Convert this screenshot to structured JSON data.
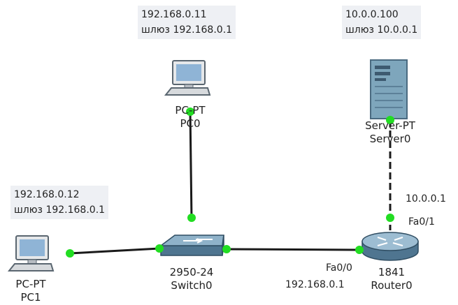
{
  "notes": {
    "pc0": {
      "ip": "192.168.0.11",
      "gateway": "шлюз 192.168.0.1"
    },
    "pc1": {
      "ip": "192.168.0.12",
      "gateway": "шлюз 192.168.0.1"
    },
    "server0": {
      "ip": "10.0.0.100",
      "gateway": "шлюз 10.0.0.1"
    }
  },
  "devices": {
    "pc0": {
      "model": "PC-PT",
      "name": "PC0"
    },
    "pc1": {
      "model": "PC-PT",
      "name": "PC1"
    },
    "switch0": {
      "model": "2950-24",
      "name": "Switch0"
    },
    "router0": {
      "model": "1841",
      "name": "Router0"
    },
    "server0": {
      "model": "Server-PT",
      "name": "Server0"
    }
  },
  "ports": {
    "router_fa00": "Fa0/0",
    "router_fa00_ip": "192.168.0.1",
    "router_fa01": "Fa0/1",
    "router_fa01_ip": "10.0.0.1"
  },
  "colors": {
    "link": "#1a1a1a",
    "link_up": "#22dd22",
    "note_bg": "#eef0f4",
    "pc_screen": "#8fb4d6",
    "device_steel": "#6a8fa8",
    "server_body": "#7ea6bc"
  }
}
